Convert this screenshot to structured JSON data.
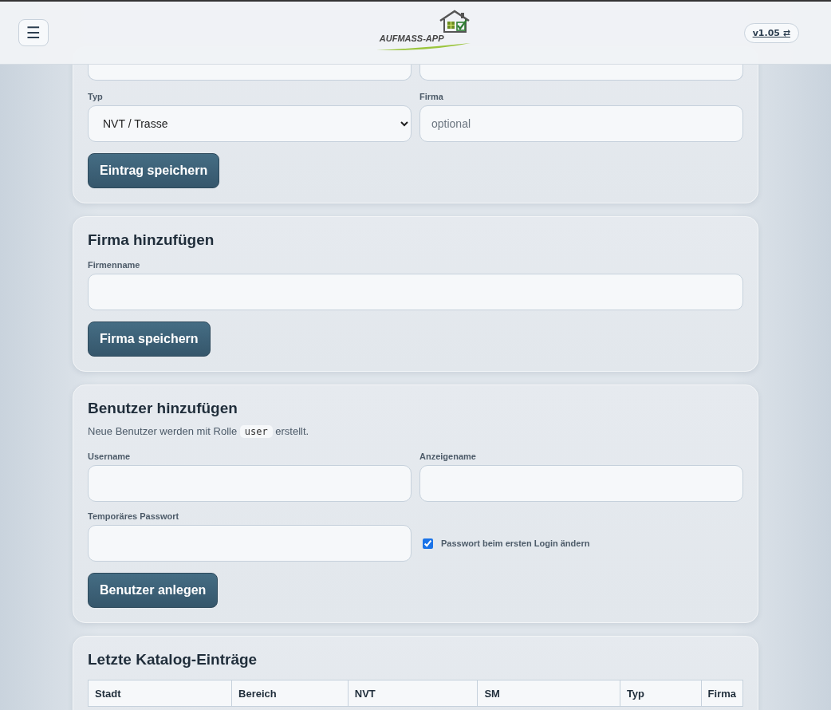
{
  "header": {
    "menu_icon": "☰",
    "logo_text": "AUFMASS-APP",
    "version": "v1.05 ⇄"
  },
  "entry_form": {
    "top_fields": [
      {
        "kind": "input"
      },
      {
        "kind": "input"
      }
    ],
    "fields": [
      {
        "kind": "select",
        "label": "Typ",
        "value": "NVT / Trasse"
      },
      {
        "kind": "input",
        "label": "Firma",
        "placeholder": "optional"
      }
    ],
    "button": "Eintrag speichern"
  },
  "company_form": {
    "title": "Firma hinzufügen",
    "field_label": "Firmenname",
    "button": "Firma speichern"
  },
  "user_form": {
    "title": "Benutzer hinzufügen",
    "note_before": "Neue Benutzer werden mit Rolle",
    "role": "user",
    "note_after": "erstellt.",
    "fields": [
      {
        "kind": "input",
        "label": "Username"
      },
      {
        "kind": "input",
        "label": "Anzeigename"
      },
      {
        "kind": "input",
        "label": "Temporäres Passwort"
      },
      {
        "kind": "checkbox",
        "label": "Passwort beim ersten Login ändern",
        "checked": true
      }
    ],
    "button": "Benutzer anlegen"
  },
  "catalog": {
    "title": "Letzte Katalog-Einträge",
    "columns": [
      "Stadt",
      "Bereich",
      "NVT",
      "SM",
      "Typ",
      "Firma"
    ]
  }
}
